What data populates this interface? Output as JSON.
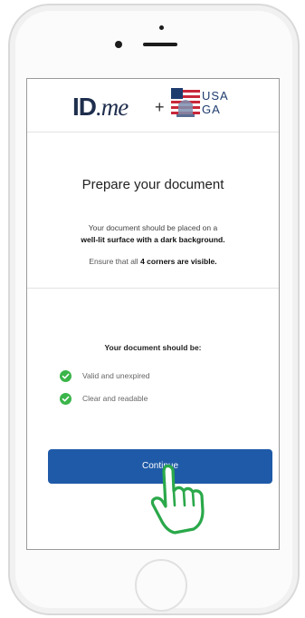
{
  "header": {
    "logo_id": "ID",
    "logo_me": ".me",
    "plus": "+",
    "partner_line1": "USA",
    "partner_line2": "GA"
  },
  "content": {
    "title": "Prepare your document",
    "instruction_line1": "Your document should be placed on a",
    "instruction_line2": "well-lit surface with a dark background.",
    "ensure_prefix": "Ensure that all ",
    "ensure_bold": "4 corners are visible.",
    "checklist_title": "Your document should be:",
    "checklist": [
      {
        "label": "Valid and unexpired",
        "icon": "check-circle-icon"
      },
      {
        "label": "Clear and readable",
        "icon": "check-circle-icon"
      }
    ],
    "continue_label": "Continue"
  },
  "colors": {
    "accent": "#1f5aa8",
    "check": "#3bb54a",
    "hand": "#2aa84a"
  }
}
